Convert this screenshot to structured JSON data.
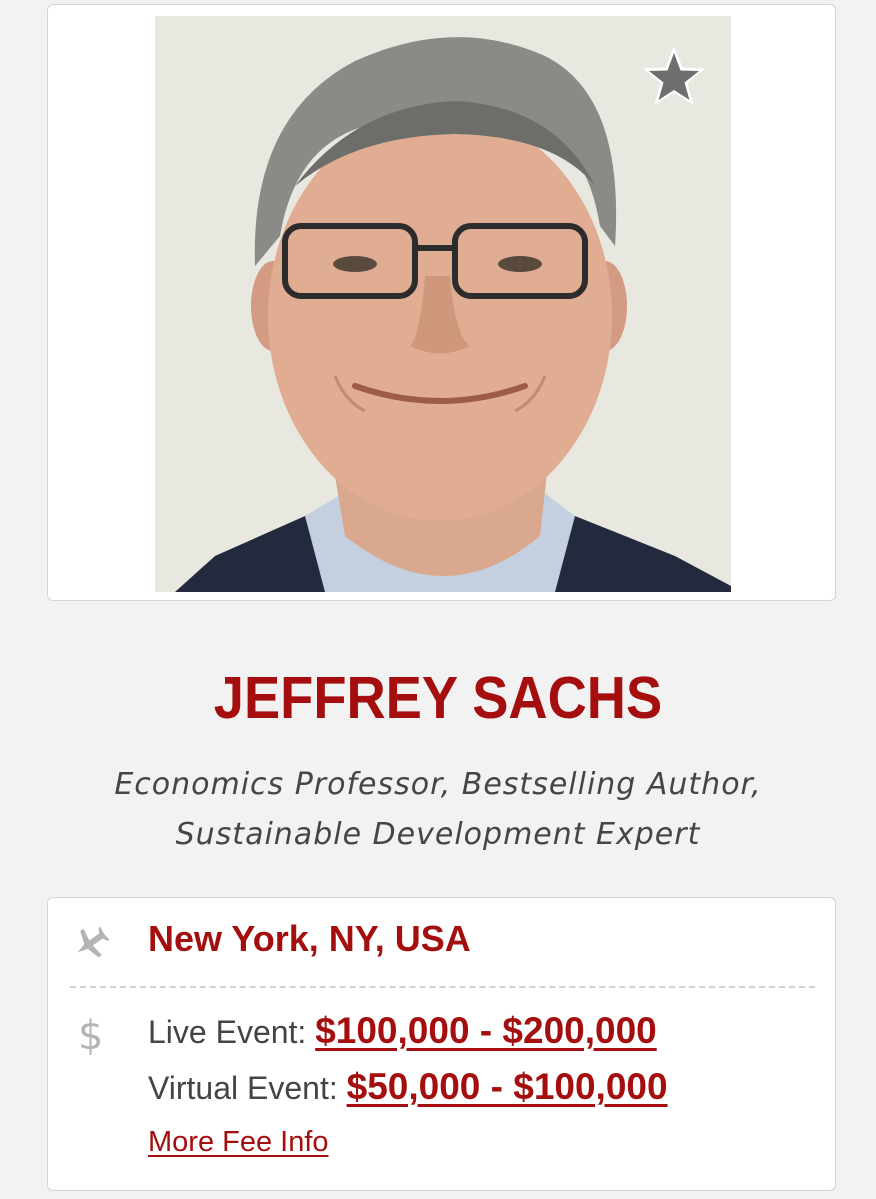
{
  "profile": {
    "name": "JEFFREY SACHS",
    "title_line_1": "Economics Professor, Bestselling Author,",
    "title_line_2": "Sustainable Development Expert",
    "photo_icon": "headshot-photo",
    "favorite_icon": "star-icon"
  },
  "info": {
    "location_icon": "airplane-icon",
    "location": "New York, NY, USA",
    "fee_icon": "dollar-icon",
    "fee_symbol": "$",
    "live_label": "Live Event:",
    "live_fee": "$100,000 - $200,000",
    "virtual_label": "Virtual Event:",
    "virtual_fee": "$50,000 - $100,000",
    "more_fee_link": "More Fee Info"
  },
  "colors": {
    "accent": "#a50e0e",
    "background": "#f2f2f2",
    "card": "#ffffff",
    "muted_text": "#444444",
    "icon_gray": "#b4b4b4"
  }
}
